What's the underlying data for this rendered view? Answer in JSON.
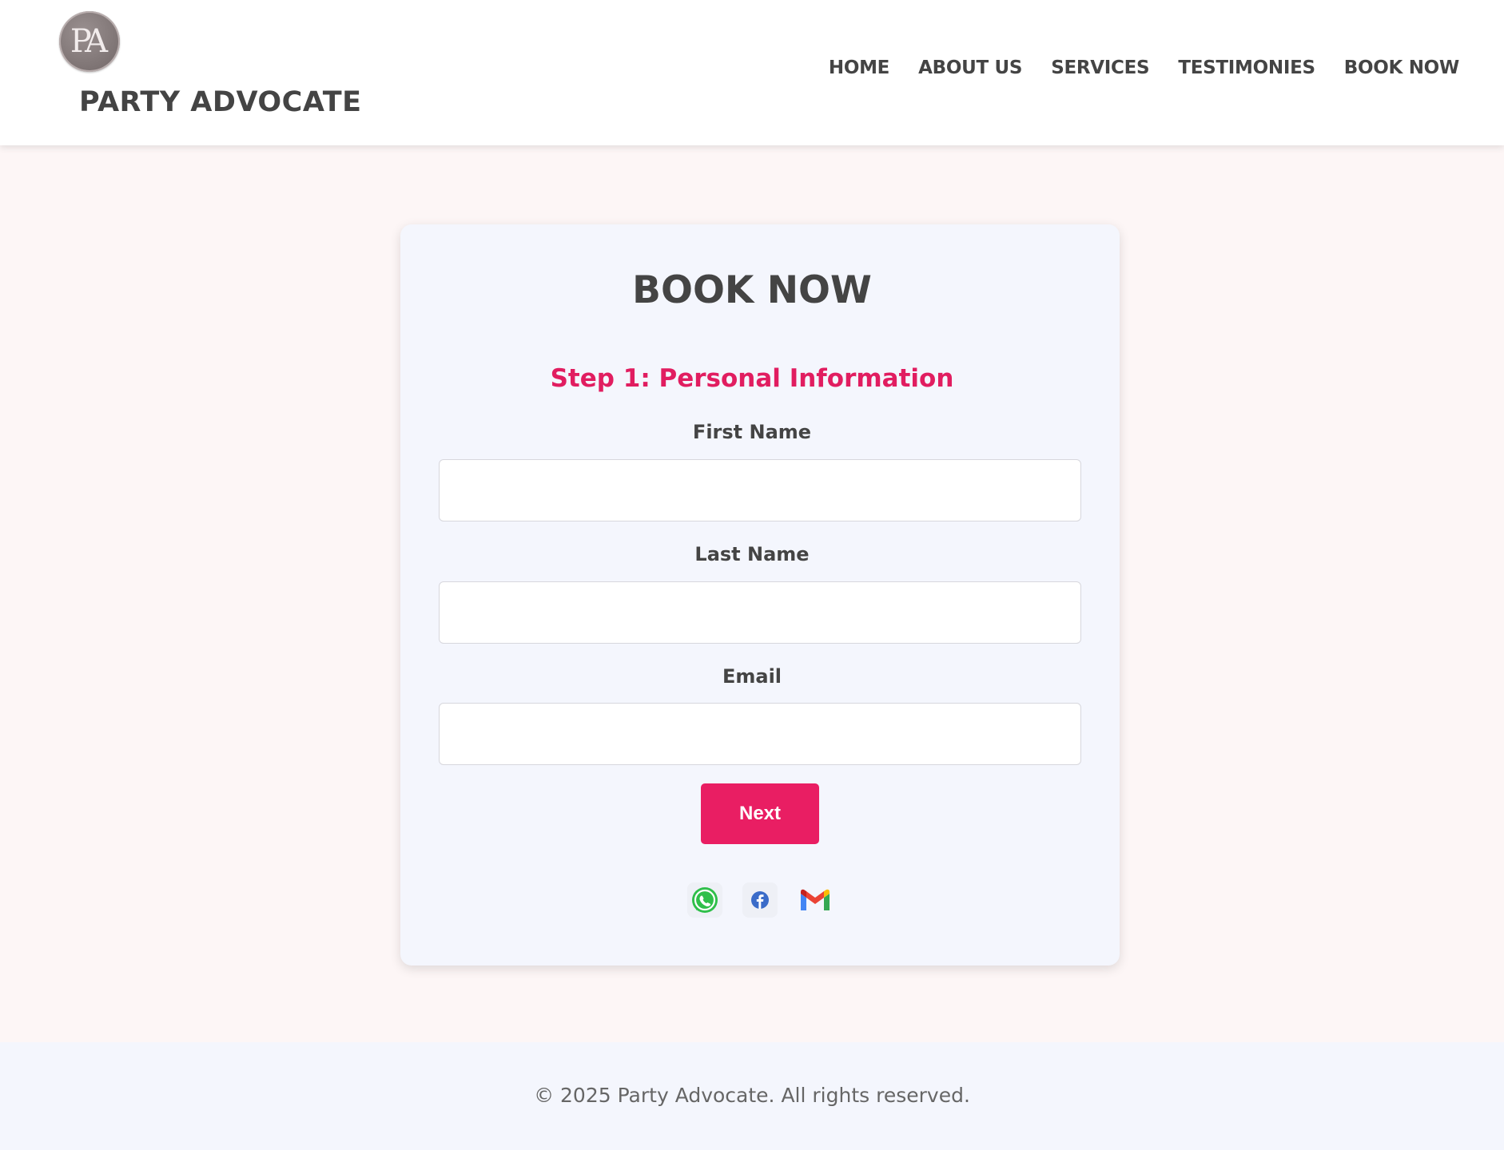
{
  "header": {
    "logo_monogram": "PA",
    "brand_name": "PARTY ADVOCATE",
    "nav": [
      {
        "label": "HOME"
      },
      {
        "label": "ABOUT US"
      },
      {
        "label": "SERVICES"
      },
      {
        "label": "TESTIMONIES"
      },
      {
        "label": "BOOK NOW"
      }
    ]
  },
  "form": {
    "title": "BOOK NOW",
    "step_title": "Step 1: Personal Information",
    "fields": [
      {
        "label": "First Name",
        "value": ""
      },
      {
        "label": "Last Name",
        "value": ""
      },
      {
        "label": "Email",
        "value": ""
      }
    ],
    "next_label": "Next",
    "social_icons": [
      "whatsapp-icon",
      "facebook-icon",
      "gmail-icon"
    ]
  },
  "footer": {
    "copyright": "© 2025 Party Advocate. All rights reserved."
  },
  "colors": {
    "accent": "#e91e63",
    "text": "#444444",
    "page_bg": "#fdf6f6",
    "card_bg": "#f4f6fd"
  }
}
